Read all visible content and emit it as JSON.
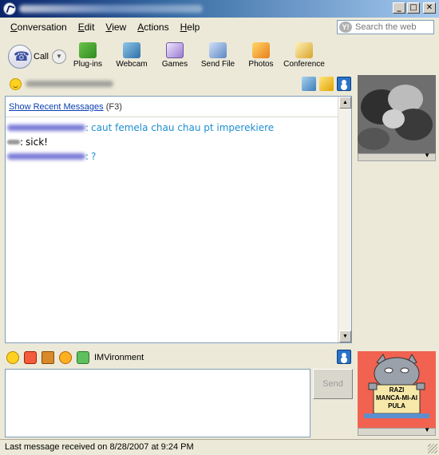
{
  "window": {
    "buttons": {
      "minimize": "_",
      "maximize": "□",
      "close": "✕"
    }
  },
  "menu": {
    "items": [
      {
        "key": "C",
        "rest": "onversation"
      },
      {
        "key": "E",
        "rest": "dit"
      },
      {
        "key": "V",
        "rest": "iew"
      },
      {
        "key": "A",
        "rest": "ctions"
      },
      {
        "key": "H",
        "rest": "elp"
      }
    ],
    "search_placeholder": "Search the web",
    "search_logo": "Y!"
  },
  "toolbar": {
    "call_label": "Call",
    "dropdown_glyph": "▼",
    "tools": [
      {
        "label": "Plug-ins",
        "icon": "plugin-icon"
      },
      {
        "label": "Webcam",
        "icon": "webcam-icon"
      },
      {
        "label": "Games",
        "icon": "dice-icon"
      },
      {
        "label": "Send File",
        "icon": "send-file-icon"
      },
      {
        "label": "Photos",
        "icon": "photos-icon"
      },
      {
        "label": "Conference",
        "icon": "conference-icon"
      }
    ]
  },
  "conversation": {
    "show_recent_link": "Show Recent Messages",
    "show_recent_shortcut": "(F3)",
    "messages": [
      {
        "text": "caut femela  chau chau pt imperekiere",
        "color": "#1e8fd0"
      },
      {
        "text": "sick!",
        "color": "#000000"
      },
      {
        "text": "?",
        "color": "#1e8fd0"
      }
    ],
    "colon": ":",
    "scroll_up": "▲",
    "scroll_down": "▼"
  },
  "emoticon_bar": {
    "imvironment_label": "IMVironment"
  },
  "send_button": {
    "label": "Send"
  },
  "display_image": {
    "sign_lines": [
      "RAZI",
      "MANCA-MI-AI",
      "PULA"
    ]
  },
  "statusbar": {
    "text": "Last message received on 8/28/2007 at 9:24 PM"
  },
  "colors": {
    "title_bar": "#0a246a",
    "window_bg": "#ece9d8",
    "link": "#0a3fb0",
    "message_blue": "#1e8fd0",
    "avatar_bg": "#f26250"
  }
}
